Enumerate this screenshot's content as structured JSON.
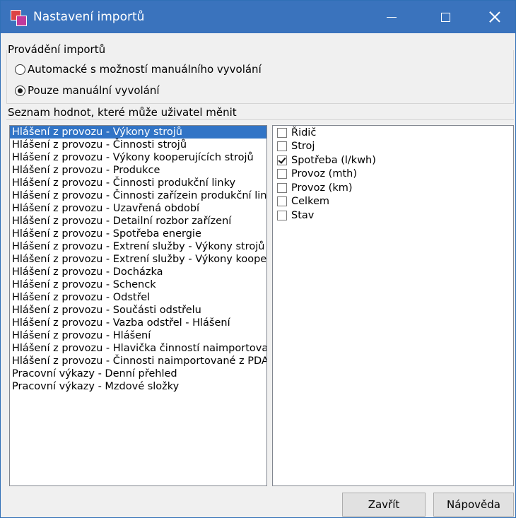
{
  "window": {
    "title": "Nastavení importů"
  },
  "import_group": {
    "label": "Provádění importů",
    "options": [
      {
        "label": "Automacké s možností manuálního vyvolání",
        "checked": false
      },
      {
        "label": "Pouze manuální vyvolání",
        "checked": true
      }
    ]
  },
  "values_group": {
    "label": "Seznam hodnot, které může uživatel měnit",
    "selected_index": 0,
    "items": [
      "Hlášení z provozu - Výkony strojů",
      "Hlášení z provozu - Činnosti strojů",
      "Hlášení z provozu - Výkony kooperujících strojů",
      "Hlášení z provozu - Produkce",
      "Hlášení z provozu - Činnosti produkční linky",
      "Hlášení z provozu - Činnosti zařízein produkční linky",
      "Hlášení z provozu - Uzavřená období",
      "Hlášení z provozu - Detailní rozbor zařízení",
      "Hlášení z provozu - Spotřeba energie",
      "Hlášení z provozu - Extrení služby - Výkony strojů",
      "Hlášení z provozu - Extrení služby - Výkony kooperujících",
      "Hlášení z provozu - Docházka",
      "Hlášení z provozu - Schenck",
      "Hlášení z provozu - Odstřel",
      "Hlášení z provozu - Součásti odstřelu",
      "Hlášení z provozu - Vazba odstřel - Hlášení",
      "Hlášení z provozu - Hlášení",
      "Hlášení z provozu - Hlavička činností naimportovaných",
      "Hlášení z provozu - Činnosti naimportované z PDA",
      "Pracovní výkazy - Denní přehled",
      "Pracovní výkazy - Mzdové složky"
    ],
    "fields": [
      {
        "label": "Řidič",
        "checked": false
      },
      {
        "label": "Stroj",
        "checked": false
      },
      {
        "label": "Spotřeba (l/kwh)",
        "checked": true
      },
      {
        "label": "Provoz (mth)",
        "checked": false
      },
      {
        "label": "Provoz (km)",
        "checked": false
      },
      {
        "label": "Celkem",
        "checked": false
      },
      {
        "label": "Stav",
        "checked": false
      }
    ]
  },
  "buttons": {
    "close": "Zavřít",
    "help": "Nápověda"
  },
  "colors": {
    "titlebar": "#3a73bd",
    "selection": "#3174c6"
  }
}
